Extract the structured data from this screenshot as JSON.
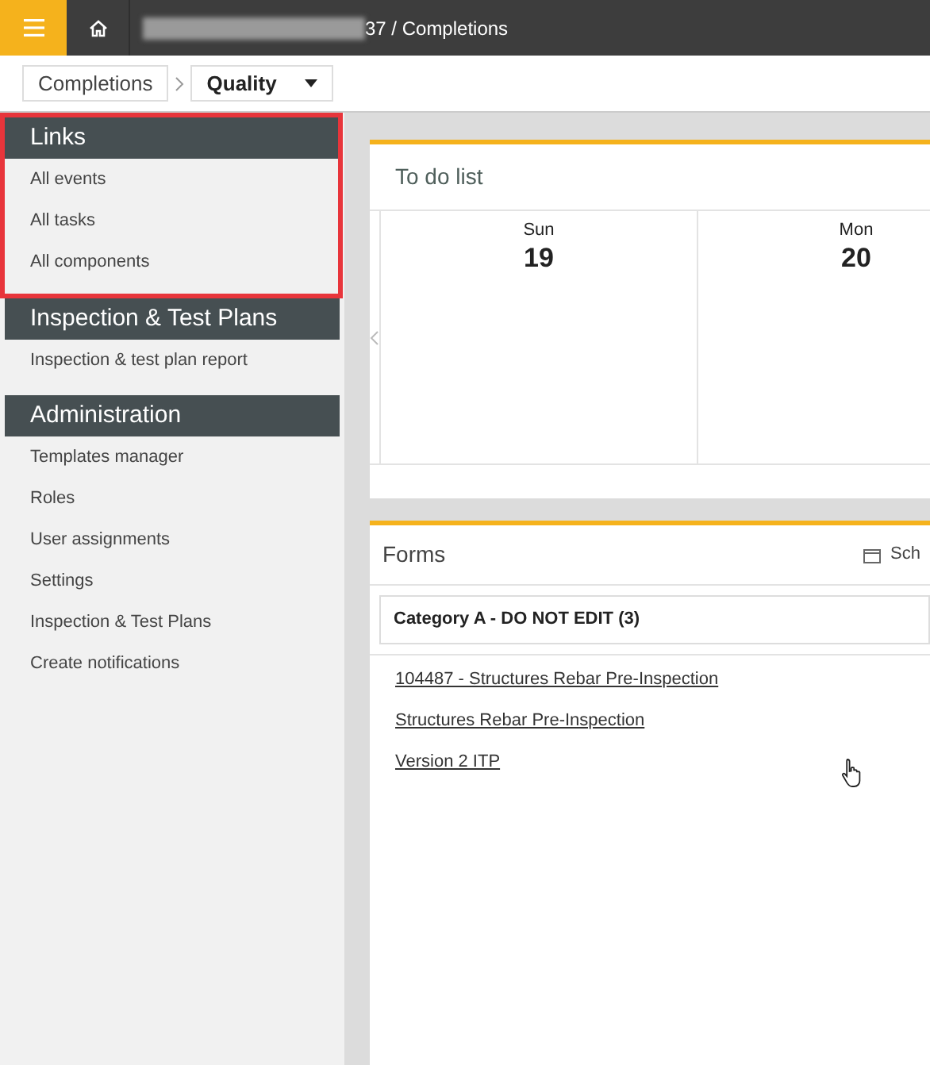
{
  "topbar": {
    "breadcrumb": "37 / Completions"
  },
  "subnav": {
    "crumb": "Completions",
    "dropdown": "Quality"
  },
  "sidebar": {
    "sections": [
      {
        "title": "Links",
        "highlighted": true,
        "items": [
          "All events",
          "All tasks",
          "All components"
        ]
      },
      {
        "title": "Inspection & Test Plans",
        "highlighted": false,
        "items": [
          "Inspection & test plan report"
        ]
      },
      {
        "title": "Administration",
        "highlighted": false,
        "items": [
          "Templates manager",
          "Roles",
          "User assignments",
          "Settings",
          "Inspection & Test Plans",
          "Create notifications"
        ]
      }
    ]
  },
  "todo": {
    "title": "To do list",
    "days": [
      {
        "day": "Sun",
        "date": "19"
      },
      {
        "day": "Mon",
        "date": "20"
      }
    ]
  },
  "forms": {
    "title": "Forms",
    "action": "Sch",
    "category": "Category A - DO NOT EDIT (3)",
    "links": [
      "104487 - Structures Rebar Pre-Inspection",
      "Structures Rebar Pre-Inspection",
      "Version 2 ITP"
    ]
  }
}
